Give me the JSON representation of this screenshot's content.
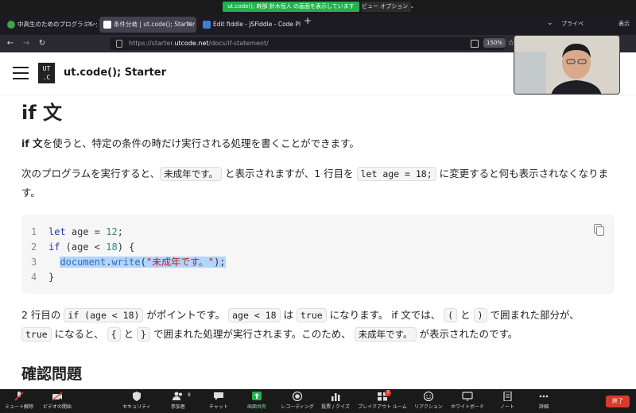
{
  "zoom_banner": {
    "sharing_text": "ut.code(); 幹部 鈴木恒人 の画面を表示しています",
    "view_options": "ビュー オプション ⌄"
  },
  "browser": {
    "tabs": [
      {
        "label": "中高生のためのプログラミング講座",
        "active": false
      },
      {
        "label": "条件分岐 | ut.code(); Starter",
        "active": true
      },
      {
        "label": "Edit fiddle - JSFiddle - Code Playground",
        "active": false
      }
    ],
    "new_tab": "+",
    "private_label": "プライベ",
    "display_label": "表示",
    "url_prefix": "https://starter.",
    "url_domain": "utcode.net",
    "url_path": "/docs/if-statement/",
    "zoom": "150%"
  },
  "site": {
    "logo_line1": "UT",
    "logo_line2": ".C",
    "title": "ut.code(); Starter"
  },
  "article": {
    "heading": "if 文",
    "p1_kw": "if 文",
    "p1_rest": "を使うと、特定の条件の時だけ実行される処理を書くことができます。",
    "p2_a": "次のプログラムを実行すると、",
    "p2_code1": "未成年です。",
    "p2_b": " と表示されますが、1 行目を ",
    "p2_code2": "let age = 18;",
    "p2_c": " に変更すると何も表示されなくなります。",
    "code": {
      "line1": {
        "no": "1",
        "kw": "let",
        "mid": " age = ",
        "num": "12",
        "end": ";"
      },
      "line2": {
        "no": "2",
        "kw": "if",
        "mid": " (age < ",
        "num": "18",
        "end": ") {"
      },
      "line3": {
        "no": "3",
        "obj": "document",
        "dot": ".",
        "fn": "write",
        "open": "(",
        "str": "\"未成年です。\"",
        "close": ");"
      },
      "line4": {
        "no": "4",
        "text": "}"
      }
    },
    "p3_a": "2 行目の ",
    "p3_code1": "if (age < 18)",
    "p3_b": " がポイントです。 ",
    "p3_code2": "age < 18",
    "p3_c": " は ",
    "p3_code3": "true",
    "p3_d": " になります。 if 文では、 ",
    "p3_code4": "(",
    "p3_e": " と ",
    "p3_code5": ")",
    "p3_f": " で囲まれた部分が、",
    "p4_code1": "true",
    "p4_a": " になると、 ",
    "p4_code2": "{",
    "p4_b": " と ",
    "p4_code3": "}",
    "p4_c": " で囲まれた処理が実行されます。このため、 ",
    "p4_code4": "未成年です。",
    "p4_d": " が表示されたのです。",
    "section_heading": "確認問題"
  },
  "zoom_toolbar": {
    "items": [
      {
        "label": "ミュート解除"
      },
      {
        "label": "ビデオの開始"
      },
      {
        "label": "セキュリティ"
      },
      {
        "label": "参加者"
      },
      {
        "label": "チャット"
      },
      {
        "label": "画面共有"
      },
      {
        "label": "レコーディング"
      },
      {
        "label": "投票 / クイズ"
      },
      {
        "label": "ブレイクアウト ルーム"
      },
      {
        "label": "リアクション"
      },
      {
        "label": "ホワイトボード"
      },
      {
        "label": "ノート"
      },
      {
        "label": "詳細"
      }
    ],
    "participants_count": "8",
    "breakout_badge": "7",
    "end_label": "終了"
  },
  "colors": {
    "zoom_green": "#22b14c",
    "end_red": "#d93a2b",
    "selection": "#b3d4fc"
  }
}
